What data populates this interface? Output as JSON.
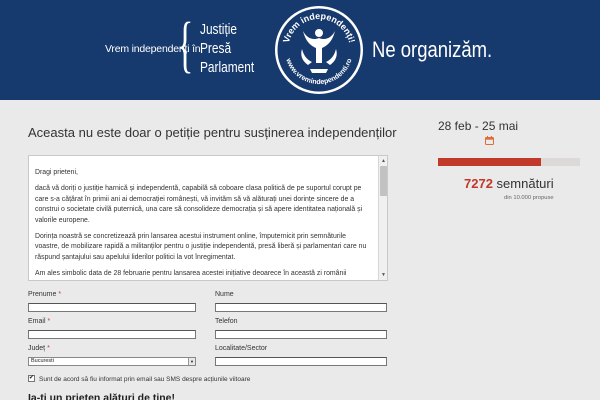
{
  "header": {
    "lead": "Vrem independenți în",
    "pillars": [
      "Justiție",
      "Presă",
      "Parlament"
    ],
    "logo_top_text": "Vrem independenți!",
    "logo_bottom_text": "www.vremindependenti.ro",
    "tagline": "Ne organizăm.",
    "brand_color": "#173a6e"
  },
  "intro": {
    "title": "Aceasta nu este doar o petiție pentru susținerea independenților"
  },
  "petition": {
    "greeting": "Dragi prieteni,",
    "p1": "dacă vă doriți o justiție harnică și independentă, capabilă să coboare clasa politică de pe suportul corupt pe care s-a cățărat în primii ani ai democrației românești, vă invităm să vă alăturați unei dorințe sincere de a construi o societate civilă puternică, una care să consolideze democrația și să apere identitatea națională și valorile europene.",
    "p2": "Dorința noastră se concretizează prin lansarea acestui instrument online, împuternicit prin semnăturile voastre, de mobilizare rapidă a militanților pentru o justiție independentă, presă liberă și parlamentari care nu răspund șantajului sau apelului liderilor politici la vot înregimentat.",
    "p3": "Am ales simbolic data de 28 februarie pentru lansarea acestei inițiative deoarece în această zi românii"
  },
  "form": {
    "first_name_label": "Prenume",
    "last_name_label": "Nume",
    "email_label": "Email",
    "phone_label": "Telefon",
    "county_label": "Județ",
    "county_value": "Bucuresti",
    "locality_label": "Localitate/Sector",
    "required_mark": "*",
    "consent_label": "Sunt de acord să fiu informat prin email sau SMS despre acțiunile viitoare",
    "consent_checked": true,
    "join_text": "Ia-ți un prieten alături de tine!"
  },
  "campaign": {
    "dates": "28 feb - 25 mai",
    "signatures": "7272",
    "signatures_label": "semnături",
    "goal_text": "din 10.000 propuse",
    "progress": 0.7272,
    "accent_color": "#c0392b"
  }
}
